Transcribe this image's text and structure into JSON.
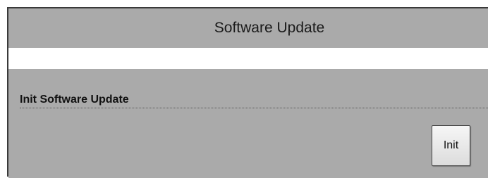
{
  "header": {
    "title": "Software Update"
  },
  "section": {
    "label": "Init Software Update",
    "init_button_label": "Init"
  },
  "colors": {
    "panel_background": "#aaaaaa",
    "frame_border": "#3a3a3a",
    "button_background": "#eeeeee"
  }
}
